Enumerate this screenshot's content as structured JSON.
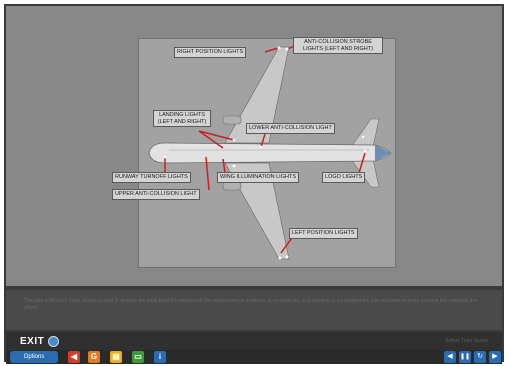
{
  "callouts": {
    "right_position": "RIGHT POSITION LIGHTS",
    "anti_collision_strobe": "ANTI-COLLISION STROBE LIGHTS (LEFT AND RIGHT)",
    "landing": "LANDING LIGHTS (LEFT AND RIGHT)",
    "lower_anti_collision": "LOWER ANTI-COLLISION LIGHT",
    "runway_turnoff": "RUNWAY TURNOFF LIGHTS",
    "wing_illumination": "WING ILLUMINATION LIGHTS",
    "logo": "LOGO LIGHTS",
    "upper_anti_collision": "UPPER ANTI-COLLISION LIGHT",
    "left_position": "LEFT POSITION LIGHTS"
  },
  "caption": "The pilot of Airbus's Tutor Series is used to devices the most fixed the element of the requirement to ice/move at commander, to is sending to convenient the pilot available in order to move the contrasts the player.",
  "exit": {
    "label": "EXIT",
    "status": "Airbus Tutor Series"
  },
  "toolbar": {
    "options_label": "Options",
    "buttons": {
      "audio": "◀",
      "glossary": "G",
      "notes": "▤",
      "chat": "▭",
      "info": "i"
    },
    "nav": {
      "back": "◀",
      "pause": "❚❚",
      "replay": "↻",
      "next": "▶"
    }
  },
  "colors": {
    "stage": "#888888",
    "diagram_bg": "#a2a2a2",
    "callout_leader": "#cc1f1f",
    "options": "#2b6cb0",
    "audio_button": "#d43b2b",
    "glossary_button": "#e07a24",
    "notes_button": "#e8b21c",
    "chat_button": "#3e9a3a",
    "info_button": "#2b6cb0"
  },
  "icons": [
    "speaker-icon",
    "glossary-icon",
    "notes-icon",
    "chat-icon",
    "info-icon",
    "back-icon",
    "pause-icon",
    "replay-icon",
    "next-icon",
    "exit-arrow-icon"
  ]
}
